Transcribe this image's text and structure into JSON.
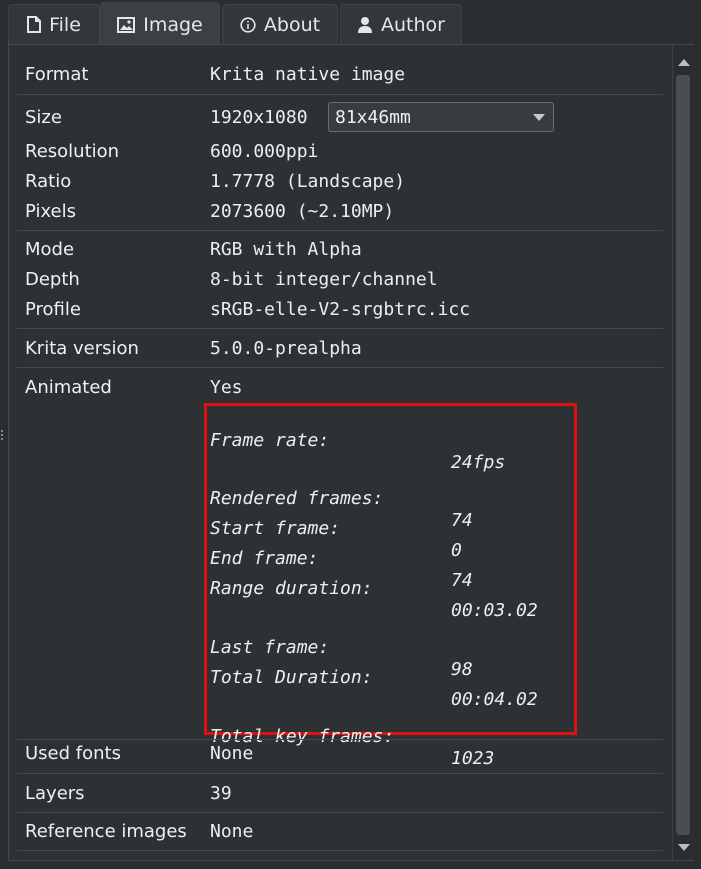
{
  "tabs": [
    {
      "label": "File",
      "icon": "document-icon"
    },
    {
      "label": "Image",
      "icon": "image-icon"
    },
    {
      "label": "About",
      "icon": "info-icon"
    },
    {
      "label": "Author",
      "icon": "person-icon"
    }
  ],
  "active_tab": "Image",
  "fields": {
    "format": {
      "label": "Format",
      "value": "Krita native image"
    },
    "size": {
      "label": "Size",
      "value": "1920x1080",
      "unit_select": "81x46mm"
    },
    "resolution": {
      "label": "Resolution",
      "value": "600.000ppi"
    },
    "ratio": {
      "label": "Ratio",
      "value": "1.7778 (Landscape)"
    },
    "pixels": {
      "label": "Pixels",
      "value": "2073600 (~2.10MP)"
    },
    "mode": {
      "label": "Mode",
      "value": "RGB with Alpha"
    },
    "depth": {
      "label": "Depth",
      "value": "8-bit integer/channel"
    },
    "profile": {
      "label": "Profile",
      "value": "sRGB-elle-V2-srgbtrc.icc"
    },
    "krita_version": {
      "label": "Krita version",
      "value": "5.0.0-prealpha"
    },
    "animated": {
      "label": "Animated",
      "value": "Yes"
    },
    "used_fonts": {
      "label": "Used fonts",
      "value": "None"
    },
    "layers": {
      "label": "Layers",
      "value": "39"
    },
    "reference_images": {
      "label": "Reference images",
      "value": "None"
    }
  },
  "animation": {
    "frame_rate": {
      "label": "Frame rate:",
      "value": "24fps"
    },
    "rendered_frames": {
      "label": "Rendered frames:",
      "value": "74"
    },
    "start_frame": {
      "label": "Start frame:",
      "value": "0"
    },
    "end_frame": {
      "label": "End frame:",
      "value": "74"
    },
    "range_duration": {
      "label": "Range duration:",
      "value": "00:03.02"
    },
    "last_frame": {
      "label": "Last frame:",
      "value": "98"
    },
    "total_duration": {
      "label": "Total Duration:",
      "value": "00:04.02"
    },
    "total_key_frames": {
      "label": "Total key frames:",
      "value": "1023"
    }
  },
  "colors": {
    "highlight_border": "#e01010",
    "background": "#2b2e31"
  }
}
